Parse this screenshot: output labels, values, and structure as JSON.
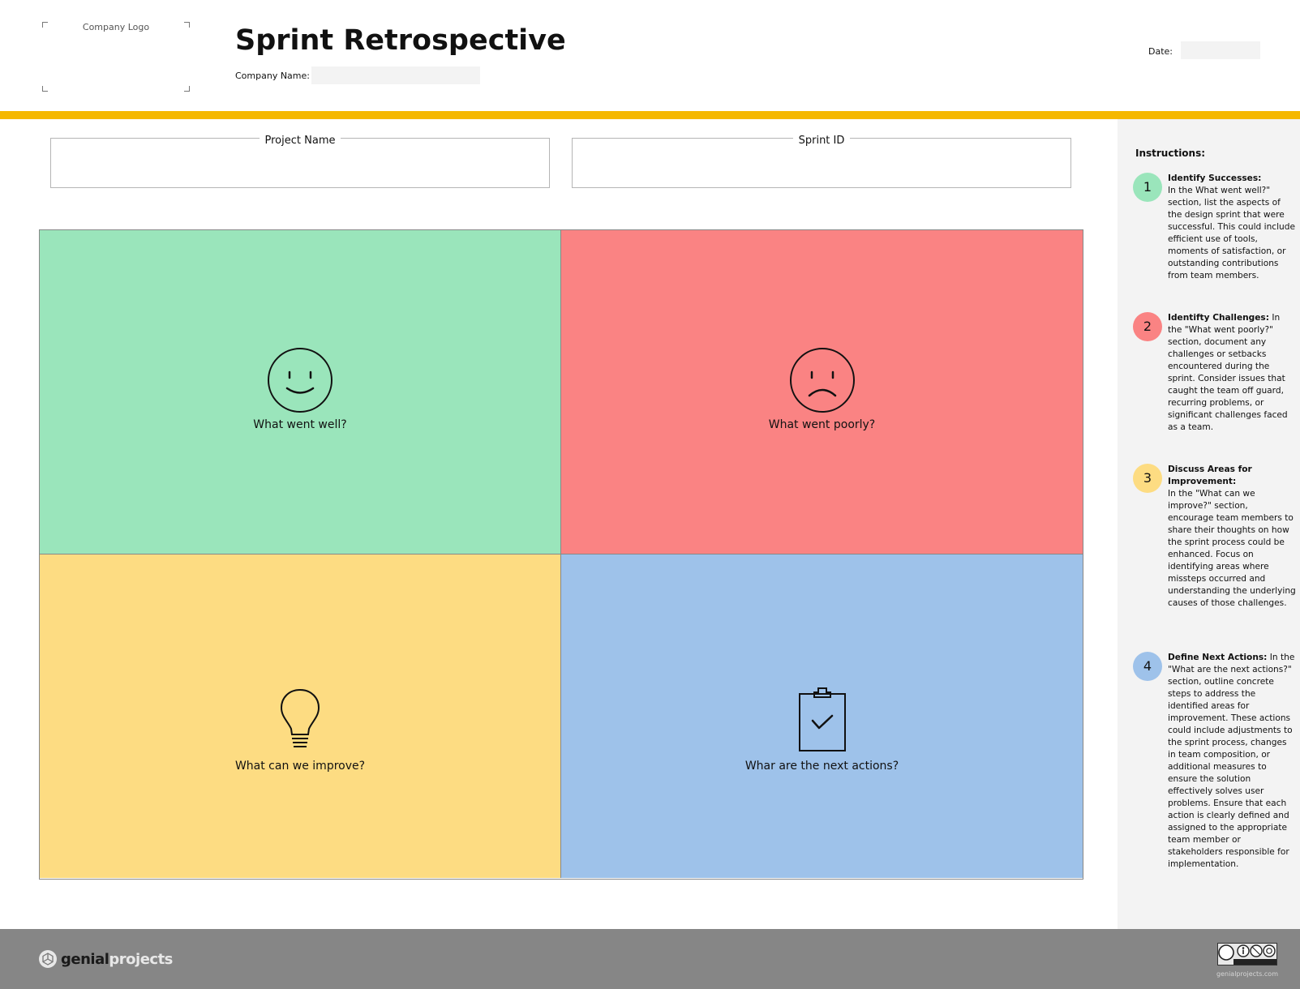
{
  "header": {
    "logo_placeholder": "Company Logo",
    "title": "Sprint Retrospective",
    "company_name_label": "Company Name:",
    "company_name_value": "",
    "date_label": "Date:",
    "date_value": ""
  },
  "fields": {
    "project_name_label": "Project Name",
    "sprint_id_label": "Sprint ID"
  },
  "quadrants": {
    "well": {
      "label": "What went well?",
      "icon": "smiley-icon",
      "color": "#9ae5bb"
    },
    "poor": {
      "label": "What went poorly?",
      "icon": "sad-face-icon",
      "color": "#fa8383"
    },
    "improve": {
      "label": "What can we improve?",
      "icon": "lightbulb-icon",
      "color": "#fddc82"
    },
    "next": {
      "label": "Whar are the next actions?",
      "icon": "clipboard-check-icon",
      "color": "#9ec2ea"
    }
  },
  "instructions": {
    "title": "Instructions:",
    "steps": [
      {
        "num": "1",
        "heading": "Identify Successes:",
        "body": "In the What went well?\" section, list the aspects of the design sprint that were successful. This could include efficient use of tools, moments of satisfaction, or outstanding contributions from team members.",
        "color": "#9ae5bb"
      },
      {
        "num": "2",
        "heading": "Identifty Challenges:",
        "body": " In the \"What went poorly?\" section, document any challenges or setbacks encountered during the sprint. Consider issues that caught the team off guard, recurring problems, or significant challenges faced as a team.",
        "color": "#fa8383"
      },
      {
        "num": "3",
        "heading": "Discuss Areas for Improvement:",
        "body": "In the \"What can we improve?\" section, encourage team members to share their thoughts on how the sprint process could be enhanced. Focus on identifying areas where missteps occurred and understanding the underlying causes of those challenges.",
        "color": "#fddc82"
      },
      {
        "num": "4",
        "heading": "Define Next Actions:",
        "body": " In the \"What are the next actions?\" section, outline concrete steps to address the identified areas for improvement. These actions could include adjustments to the sprint process, changes in team composition, or additional measures to ensure the solution effectively solves user problems. Ensure that each action is clearly defined and assigned to the appropriate team member or stakeholders responsible for implementation.",
        "color": "#9ec2ea"
      }
    ]
  },
  "footer": {
    "brand_part1": "genial",
    "brand_part2": "projects",
    "license_url": "genialprojects.com"
  }
}
